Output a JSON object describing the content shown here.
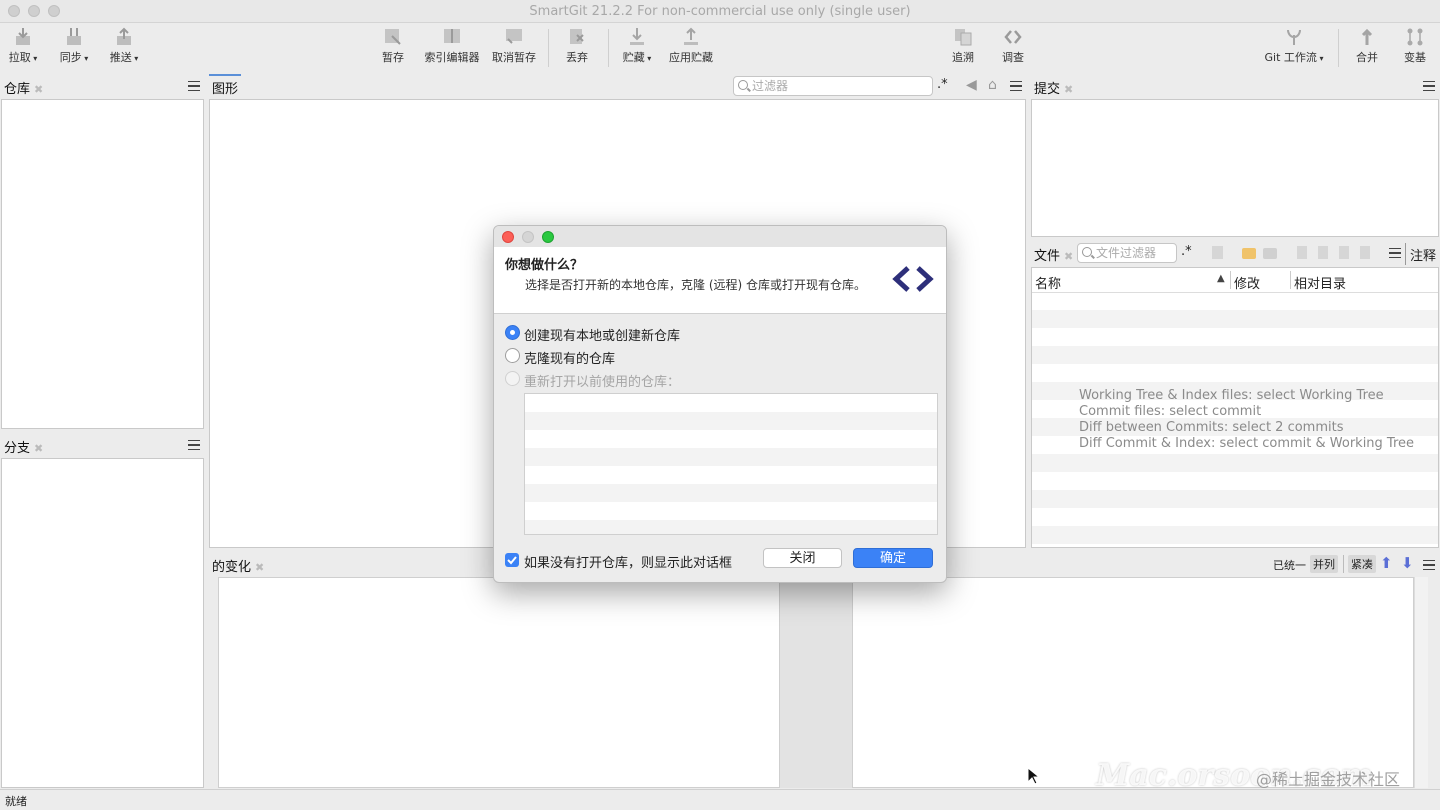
{
  "window": {
    "title": "SmartGit 21.2.2 For non-commercial use only (single user)"
  },
  "toolbar": {
    "pull": "拉取",
    "sync": "同步",
    "push": "推送",
    "stage": "暂存",
    "index_editor": "索引编辑器",
    "unstage": "取消暂存",
    "discard": "丢弃",
    "stash": "贮藏",
    "apply_stash": "应用贮藏",
    "log": "追溯",
    "investigate": "调查",
    "git_flow": "Git 工作流",
    "merge": "合并",
    "rebase": "变基"
  },
  "panels": {
    "repositories": "仓库",
    "branches": "分支",
    "graph": "图形",
    "graph_filter_placeholder": "过滤器",
    "regex": ".*",
    "commits": "提交",
    "files": "文件",
    "files_filter_placeholder": "文件过滤器",
    "notes": "注释",
    "changes": "的变化"
  },
  "files_table": {
    "columns": [
      "名称",
      "修改",
      "相对目录"
    ],
    "hints": [
      "Working Tree & Index files: select Working Tree",
      "Commit files: select commit",
      "Diff between Commits: select 2 commits",
      "Diff Commit & Index: select commit & Working Tree"
    ]
  },
  "changes_toolbar": {
    "unified": "已统一",
    "side_by_side": "并列",
    "compact": "紧凑"
  },
  "statusbar": {
    "text": "就绪"
  },
  "watermark": "Mac.orsoon.com",
  "watermark_credit": "@稀土掘金技术社区",
  "dialog": {
    "title": "你想做什么？",
    "subtitle": "选择是否打开新的本地仓库，克隆 (远程) 仓库或打开现有仓库。",
    "options": [
      {
        "label": "创建现有本地或创建新仓库",
        "selected": true,
        "enabled": true
      },
      {
        "label": "克隆现有的仓库",
        "selected": false,
        "enabled": true
      },
      {
        "label": "重新打开以前使用的仓库：",
        "selected": false,
        "enabled": false
      }
    ],
    "checkbox_label": "如果没有打开仓库，则显示此对话框",
    "checkbox_checked": true,
    "close_button": "关闭",
    "ok_button": "确定"
  },
  "colors": {
    "accent": "#3b82f6",
    "logo": "#2d2f7a"
  }
}
